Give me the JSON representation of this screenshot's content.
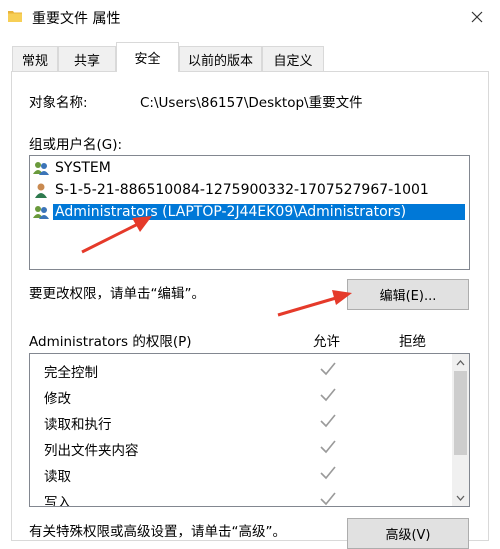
{
  "window": {
    "title": "重要文件 属性",
    "icon": "folder-icon",
    "close_icon": "close-icon"
  },
  "tabs": [
    {
      "label": "常规",
      "active": false
    },
    {
      "label": "共享",
      "active": false
    },
    {
      "label": "安全",
      "active": true
    },
    {
      "label": "以前的版本",
      "active": false
    },
    {
      "label": "自定义",
      "active": false
    }
  ],
  "object": {
    "label": "对象名称:",
    "value": "C:\\Users\\86157\\Desktop\\重要文件"
  },
  "groups": {
    "label": "组或用户名(G):",
    "items": [
      {
        "name": "SYSTEM",
        "icon": "group-icon",
        "selected": false
      },
      {
        "name": "S-1-5-21-886510084-1275900332-1707527967-1001",
        "icon": "user-icon",
        "selected": false
      },
      {
        "name": "Administrators (LAPTOP-2J44EK09\\Administrators)",
        "icon": "group-icon",
        "selected": true
      }
    ]
  },
  "edit": {
    "hint": "要更改权限，请单击“编辑”。",
    "button": "编辑(E)..."
  },
  "permissions": {
    "label": "Administrators 的权限(P)",
    "allow_header": "允许",
    "deny_header": "拒绝",
    "rows": [
      {
        "name": "完全控制",
        "allow": true,
        "deny": false
      },
      {
        "name": "修改",
        "allow": true,
        "deny": false
      },
      {
        "name": "读取和执行",
        "allow": true,
        "deny": false
      },
      {
        "name": "列出文件夹内容",
        "allow": true,
        "deny": false
      },
      {
        "name": "读取",
        "allow": true,
        "deny": false
      },
      {
        "name": "写入",
        "allow": true,
        "deny": false
      }
    ]
  },
  "advanced": {
    "hint": "有关特殊权限或高级设置，请单击“高级”。",
    "button": "高级(V)"
  },
  "colors": {
    "selection": "#0078d7",
    "annotation_arrow": "#e53a2a",
    "check_disabled": "#9a9a9a"
  }
}
